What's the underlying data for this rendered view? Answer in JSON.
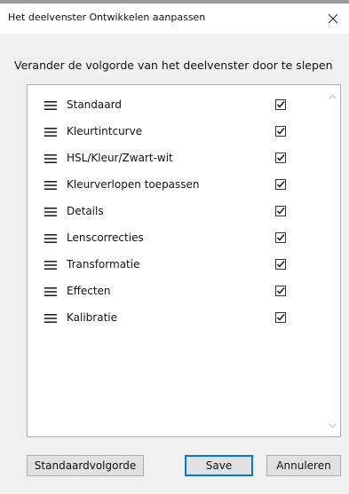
{
  "window": {
    "title": "Het deelvenster Ontwikkelen aanpassen",
    "close_icon": "close-icon"
  },
  "instruction": "Verander de volgorde van het deelvenster door te slepen",
  "panels": [
    {
      "label": "Standaard",
      "checked": true
    },
    {
      "label": "Kleurtintcurve",
      "checked": true
    },
    {
      "label": "HSL/Kleur/Zwart-wit",
      "checked": true
    },
    {
      "label": "Kleurverlopen toepassen",
      "checked": true
    },
    {
      "label": "Details",
      "checked": true
    },
    {
      "label": "Lenscorrecties",
      "checked": true
    },
    {
      "label": "Transformatie",
      "checked": true
    },
    {
      "label": "Effecten",
      "checked": true
    },
    {
      "label": "Kalibratie",
      "checked": true
    }
  ],
  "buttons": {
    "default_order": "Standaardvolgorde",
    "save": "Save",
    "cancel": "Annuleren"
  },
  "icons": {
    "drag": "drag-handle-icon",
    "check": "checkbox-checked-icon",
    "scroll_up": "chevron-up-icon",
    "scroll_down": "chevron-down-icon"
  },
  "colors": {
    "client_bg": "#f0f0f0",
    "focus_border": "#0078d7",
    "button_bg": "#e1e1e1"
  }
}
